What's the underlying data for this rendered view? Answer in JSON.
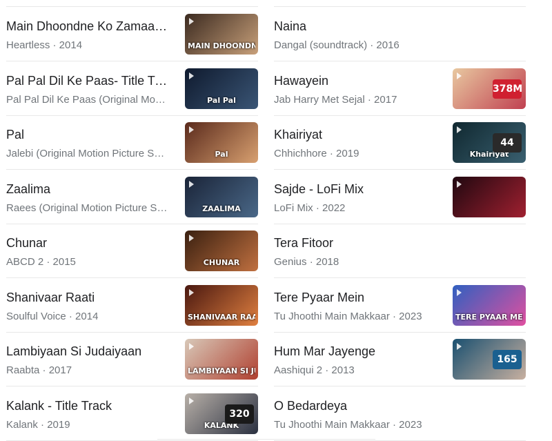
{
  "left": [
    {
      "title": "Main Dhoondne Ko Zamaane Mein",
      "subtitle": "Heartless · 2014",
      "thumb": {
        "colors": [
          "#3b2a20",
          "#c8a07a"
        ],
        "caption": "MAIN DHOONDNE KO ZAMAANE MEIN",
        "icon": "video-thumbnail-icon"
      }
    },
    {
      "title": "Pal Pal Dil Ke Paas- Title Track",
      "subtitle": "Pal Pal Dil Ke Paas (Original Motion Picture Soundtrack)",
      "thumb": {
        "colors": [
          "#0f1a2e",
          "#3a5575"
        ],
        "caption": "Pal Pal",
        "icon": "video-thumbnail-icon"
      }
    },
    {
      "title": "Pal",
      "subtitle": "Jalebi (Original Motion Picture Soundtrack)",
      "thumb": {
        "colors": [
          "#5a2a1c",
          "#d8a070"
        ],
        "caption": "Pal",
        "icon": "video-thumbnail-icon"
      }
    },
    {
      "title": "Zaalima",
      "subtitle": "Raees (Original Motion Picture Soundtrack)",
      "thumb": {
        "colors": [
          "#1a2438",
          "#4a6888"
        ],
        "caption": "ZAALIMA",
        "icon": "video-thumbnail-icon"
      }
    },
    {
      "title": "Chunar",
      "subtitle": "ABCD 2 · 2015",
      "thumb": {
        "colors": [
          "#3a2010",
          "#c07040"
        ],
        "caption": "CHUNAR",
        "icon": "video-thumbnail-icon"
      }
    },
    {
      "title": "Shanivaar Raati",
      "subtitle": "Soulful Voice · 2014",
      "thumb": {
        "colors": [
          "#4a1810",
          "#e08040"
        ],
        "caption": "SHANIVAAR RAATI",
        "icon": "video-thumbnail-icon"
      }
    },
    {
      "title": "Lambiyaan Si Judaiyaan",
      "subtitle": "Raabta · 2017",
      "thumb": {
        "colors": [
          "#d8c8b8",
          "#b04030"
        ],
        "caption": "LAMBIYAAN SI JUDAIYAAN",
        "icon": "video-thumbnail-icon"
      }
    },
    {
      "title": "Kalank - Title Track",
      "subtitle": "Kalank · 2019",
      "thumb": {
        "colors": [
          "#b8b0a8",
          "#2a3040"
        ],
        "caption": "KALANK",
        "badge": "320",
        "badge_color": "#1a1a1a",
        "icon": "video-thumbnail-icon"
      }
    }
  ],
  "right": [
    {
      "title": "Naina",
      "subtitle": "Dangal (soundtrack) · 2016",
      "thumb": null
    },
    {
      "title": "Hawayein",
      "subtitle": "Jab Harry Met Sejal · 2017",
      "thumb": {
        "colors": [
          "#e8c8a0",
          "#c04050"
        ],
        "caption": "",
        "badge": "378M",
        "badge_color": "#d02030",
        "icon": "video-thumbnail-icon"
      }
    },
    {
      "title": "Khairiyat",
      "subtitle": "Chhichhore · 2019",
      "thumb": {
        "colors": [
          "#102830",
          "#3a6070"
        ],
        "caption": "Khairiyat",
        "badge": "44",
        "badge_color": "#2a2a2a",
        "icon": "video-thumbnail-icon"
      }
    },
    {
      "title": "Sajde - LoFi Mix",
      "subtitle": "LoFi Mix · 2022",
      "thumb": {
        "colors": [
          "#200810",
          "#a02030"
        ],
        "caption": "",
        "icon": "video-thumbnail-icon"
      }
    },
    {
      "title": "Tera Fitoor",
      "subtitle": "Genius · 2018",
      "thumb": null
    },
    {
      "title": "Tere Pyaar Mein",
      "subtitle": "Tu Jhoothi Main Makkaar · 2023",
      "thumb": {
        "colors": [
          "#3060c0",
          "#e050a0"
        ],
        "caption": "TERE PYAAR MEIN",
        "icon": "video-thumbnail-icon"
      }
    },
    {
      "title": "Hum Mar Jayenge",
      "subtitle": "Aashiqui 2 · 2013",
      "thumb": {
        "colors": [
          "#1a5070",
          "#c8b0a0"
        ],
        "caption": "",
        "badge": "165",
        "badge_color": "#1a6090",
        "icon": "video-thumbnail-icon"
      }
    },
    {
      "title": "O Bedardeya",
      "subtitle": "Tu Jhoothi Main Makkaar · 2023",
      "thumb": null
    }
  ]
}
